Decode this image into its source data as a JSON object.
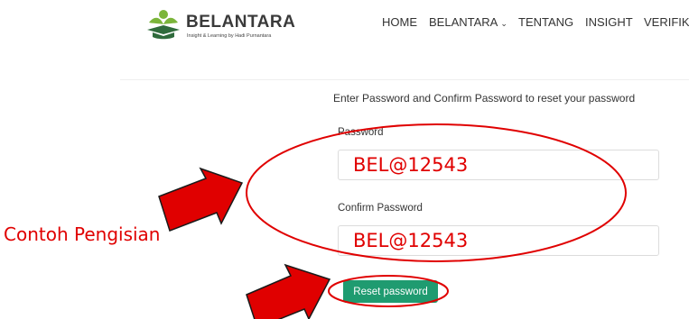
{
  "header": {
    "brand_name": "BELANTARA",
    "brand_tagline": "Insight & Learning by Hadi Purnantara",
    "nav": [
      {
        "label": "HOME"
      },
      {
        "label": "BELANTARA"
      },
      {
        "label": "TENTANG"
      },
      {
        "label": "INSIGHT"
      },
      {
        "label": "VERIFIKA"
      }
    ]
  },
  "form": {
    "intro": "Enter Password and Confirm Password to reset your password",
    "password_label": "Password",
    "password_value": "BEL@12543",
    "confirm_label": "Confirm Password",
    "confirm_value": "BEL@12543",
    "submit_label": "Reset password"
  },
  "annotation": {
    "caption": "Contoh Pengisian",
    "color": "#e00000"
  },
  "colors": {
    "button": "#1f9b70",
    "logo_green": "#7bb53a",
    "logo_dark_green": "#2f6b3c"
  }
}
